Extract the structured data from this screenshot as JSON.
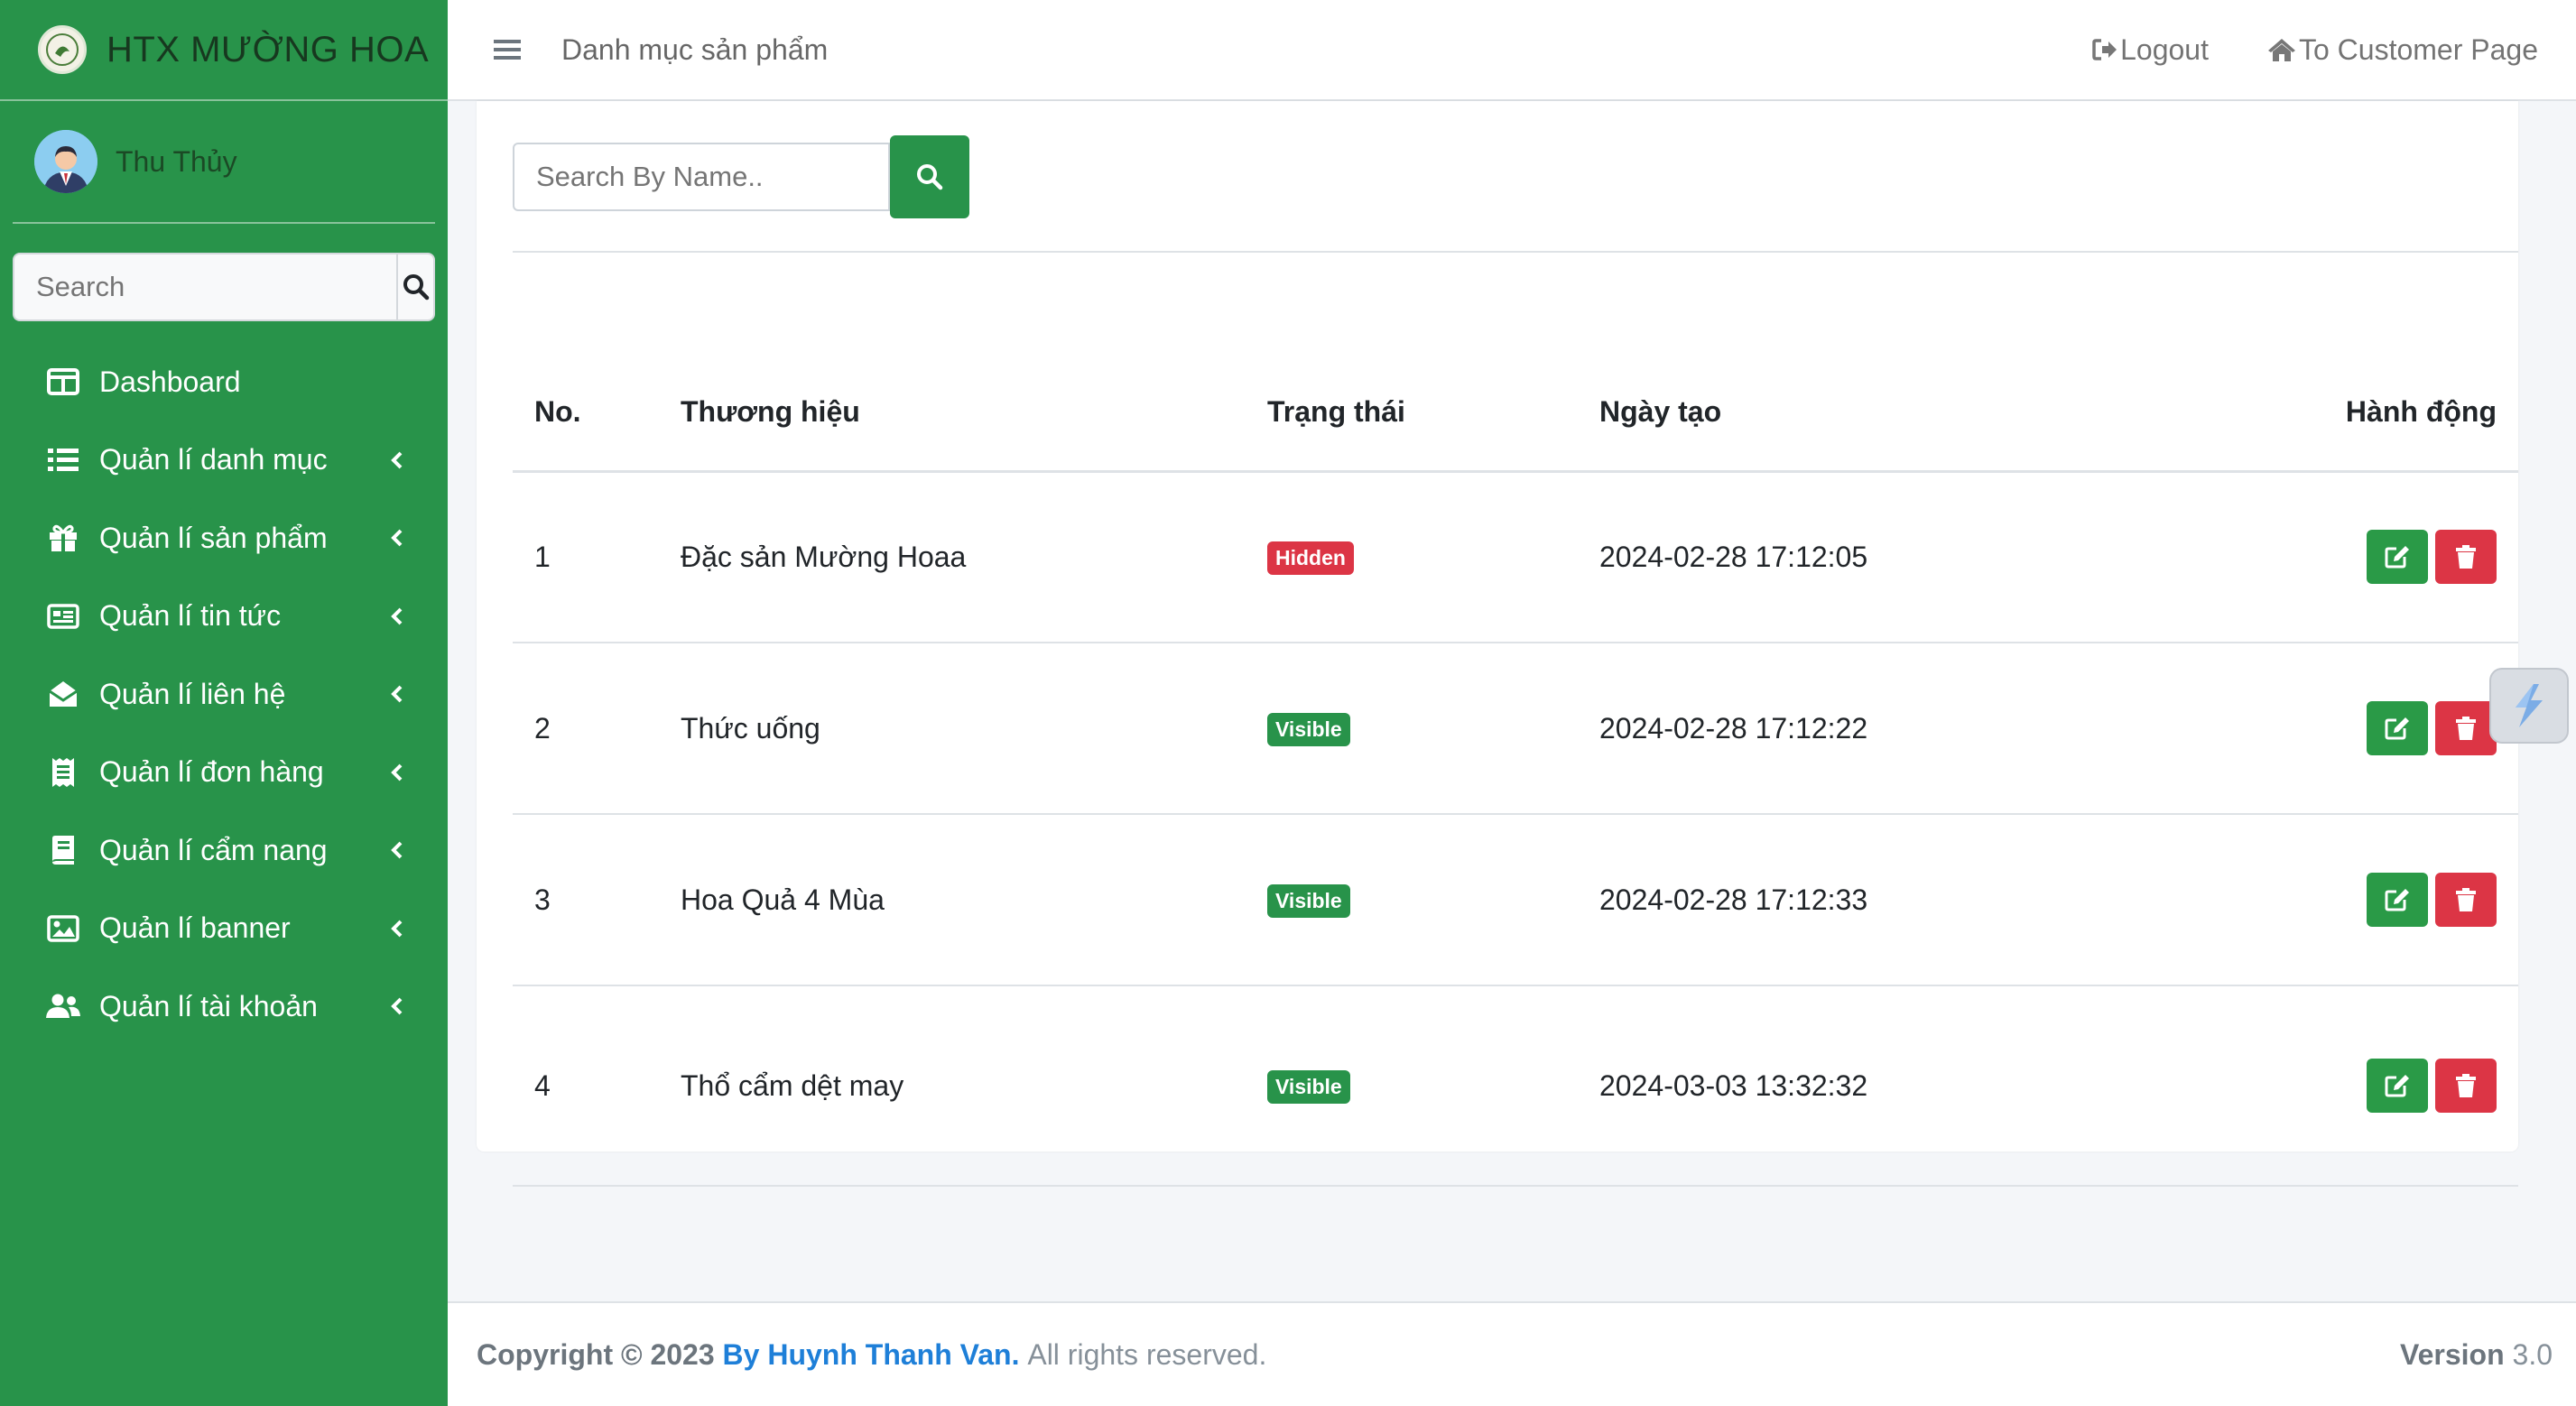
{
  "brand": {
    "name": "HTX MƯỜNG HOA"
  },
  "user": {
    "name": "Thu Thủy"
  },
  "sidebar_search": {
    "placeholder": "Search"
  },
  "nav": [
    {
      "label": "Dashboard",
      "icon": "columns-icon",
      "has_children": false
    },
    {
      "label": "Quản lí danh mục",
      "icon": "list-icon",
      "has_children": true
    },
    {
      "label": "Quản lí sản phẩm",
      "icon": "gift-icon",
      "has_children": true
    },
    {
      "label": "Quản lí tin tức",
      "icon": "newspaper-icon",
      "has_children": true
    },
    {
      "label": "Quản lí liên hệ",
      "icon": "envelope-open-icon",
      "has_children": true
    },
    {
      "label": "Quản lí đơn hàng",
      "icon": "receipt-icon",
      "has_children": true
    },
    {
      "label": "Quản lí cẩm nang",
      "icon": "book-icon",
      "has_children": true
    },
    {
      "label": "Quản lí banner",
      "icon": "image-icon",
      "has_children": true
    },
    {
      "label": "Quản lí tài khoản",
      "icon": "users-icon",
      "has_children": true
    }
  ],
  "topbar": {
    "title": "Danh mục sản phẩm",
    "logout": "Logout",
    "customer_page": "To Customer Page"
  },
  "content": {
    "search_placeholder": "Search By Name..",
    "table": {
      "headers": [
        "No.",
        "Thương hiệu",
        "Trạng thái",
        "Ngày tạo",
        "Hành động"
      ],
      "rows": [
        {
          "no": "1",
          "name": "Đặc sản Mường Hoaa",
          "status": "Hidden",
          "created": "2024-02-28 17:12:05"
        },
        {
          "no": "2",
          "name": "Thức uống",
          "status": "Visible",
          "created": "2024-02-28 17:12:22"
        },
        {
          "no": "3",
          "name": "Hoa Quả 4 Mùa",
          "status": "Visible",
          "created": "2024-02-28 17:12:33"
        },
        {
          "no": "4",
          "name": "Thổ cẩm dệt may",
          "status": "Visible",
          "created": "2024-03-03 13:32:32"
        }
      ]
    }
  },
  "footer": {
    "copyright": "Copyright © 2023",
    "author": "By Huynh Thanh Van.",
    "rights": "All rights reserved.",
    "version_label": "Version",
    "version_value": "3.0"
  },
  "colors": {
    "sidebar_bg": "#28934a",
    "accent_green": "#28934a",
    "danger": "#dc3545",
    "link_blue": "#1e7fd8"
  }
}
